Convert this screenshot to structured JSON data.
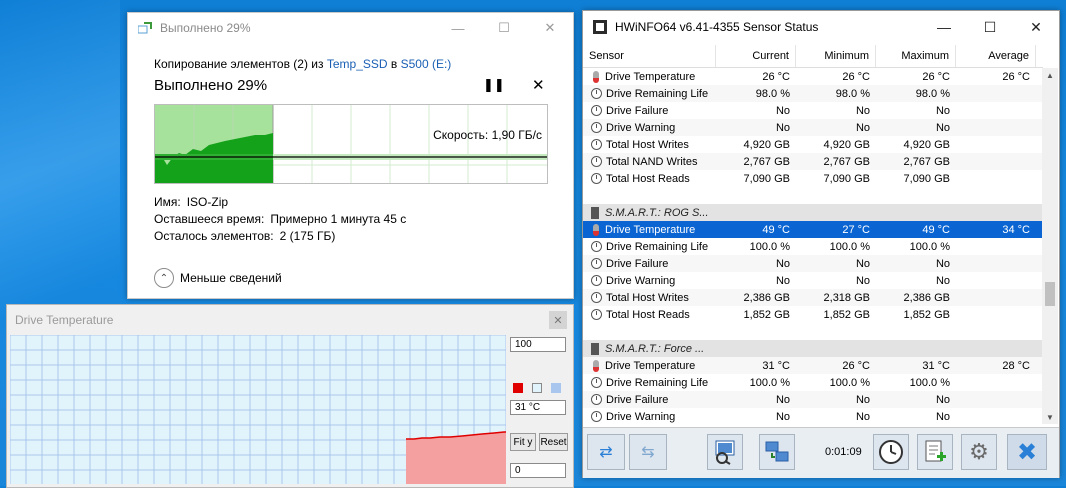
{
  "copy_dialog": {
    "title": "Выполнено 29%",
    "line_prefix": "Копирование элементов (2) из",
    "source": "Temp_SSD",
    "line_mid": "в",
    "dest": "S500 (E:)",
    "progress_title": "Выполнено 29%",
    "progress_fraction": 0.29,
    "speed": "Скорость: 1,90 ГБ/с",
    "name_label": "Имя:",
    "name_value": "ISO-Zip",
    "time_label": "Оставшееся время:",
    "time_value": "Примерно 1 минута 45 с",
    "items_label": "Осталось элементов:",
    "items_value": "2 (175 ГБ)",
    "less_details": "Меньше сведений",
    "pause_icon": "pause-icon",
    "close_icon": "close-icon"
  },
  "drive_temp_window": {
    "title": "Drive Temperature",
    "max_value": "100",
    "current_value": "31 °C",
    "min_value": "0",
    "fit_label": "Fit y",
    "reset_label": "Reset",
    "series_color": "#e00000",
    "bg_color": "#e2f4fb"
  },
  "hwinfo": {
    "title": "HWiNFO64 v6.41-4355 Sensor Status",
    "columns": [
      "Sensor",
      "Current",
      "Minimum",
      "Maximum",
      "Average"
    ],
    "rows": [
      {
        "type": "item",
        "icon": "therm",
        "name": "Drive Temperature",
        "cur": "26 °C",
        "min": "26 °C",
        "max": "26 °C",
        "avg": "26 °C"
      },
      {
        "type": "item",
        "icon": "clock",
        "name": "Drive Remaining Life",
        "cur": "98.0 %",
        "min": "98.0 %",
        "max": "98.0 %",
        "avg": ""
      },
      {
        "type": "item",
        "icon": "clock",
        "name": "Drive Failure",
        "cur": "No",
        "min": "No",
        "max": "No",
        "avg": ""
      },
      {
        "type": "item",
        "icon": "clock",
        "name": "Drive Warning",
        "cur": "No",
        "min": "No",
        "max": "No",
        "avg": ""
      },
      {
        "type": "item",
        "icon": "clock",
        "name": "Total Host Writes",
        "cur": "4,920 GB",
        "min": "4,920 GB",
        "max": "4,920 GB",
        "avg": ""
      },
      {
        "type": "item",
        "icon": "clock",
        "name": "Total NAND Writes",
        "cur": "2,767 GB",
        "min": "2,767 GB",
        "max": "2,767 GB",
        "avg": ""
      },
      {
        "type": "item",
        "icon": "clock",
        "name": "Total Host Reads",
        "cur": "7,090 GB",
        "min": "7,090 GB",
        "max": "7,090 GB",
        "avg": ""
      },
      {
        "type": "blank"
      },
      {
        "type": "group",
        "name": "S.M.A.R.T.: ROG S..."
      },
      {
        "type": "item",
        "icon": "therm",
        "name": "Drive Temperature",
        "cur": "49 °C",
        "min": "27 °C",
        "max": "49 °C",
        "avg": "34 °C",
        "selected": true
      },
      {
        "type": "item",
        "icon": "clock",
        "name": "Drive Remaining Life",
        "cur": "100.0 %",
        "min": "100.0 %",
        "max": "100.0 %",
        "avg": ""
      },
      {
        "type": "item",
        "icon": "clock",
        "name": "Drive Failure",
        "cur": "No",
        "min": "No",
        "max": "No",
        "avg": ""
      },
      {
        "type": "item",
        "icon": "clock",
        "name": "Drive Warning",
        "cur": "No",
        "min": "No",
        "max": "No",
        "avg": ""
      },
      {
        "type": "item",
        "icon": "clock",
        "name": "Total Host Writes",
        "cur": "2,386 GB",
        "min": "2,318 GB",
        "max": "2,386 GB",
        "avg": ""
      },
      {
        "type": "item",
        "icon": "clock",
        "name": "Total Host Reads",
        "cur": "1,852 GB",
        "min": "1,852 GB",
        "max": "1,852 GB",
        "avg": ""
      },
      {
        "type": "blank"
      },
      {
        "type": "group",
        "name": "S.M.A.R.T.: Force ..."
      },
      {
        "type": "item",
        "icon": "therm",
        "name": "Drive Temperature",
        "cur": "31 °C",
        "min": "26 °C",
        "max": "31 °C",
        "avg": "28 °C"
      },
      {
        "type": "item",
        "icon": "clock",
        "name": "Drive Remaining Life",
        "cur": "100.0 %",
        "min": "100.0 %",
        "max": "100.0 %",
        "avg": ""
      },
      {
        "type": "item",
        "icon": "clock",
        "name": "Drive Failure",
        "cur": "No",
        "min": "No",
        "max": "No",
        "avg": ""
      },
      {
        "type": "item",
        "icon": "clock",
        "name": "Drive Warning",
        "cur": "No",
        "min": "No",
        "max": "No",
        "avg": ""
      }
    ],
    "timer": "0:01:09",
    "toolbar_icons": [
      "nav-arrows-icon",
      "nav-arrows-alt-icon",
      "report-icon",
      "network-icon",
      "clock-icon",
      "add-layout-icon",
      "settings-icon",
      "close-icon"
    ]
  }
}
